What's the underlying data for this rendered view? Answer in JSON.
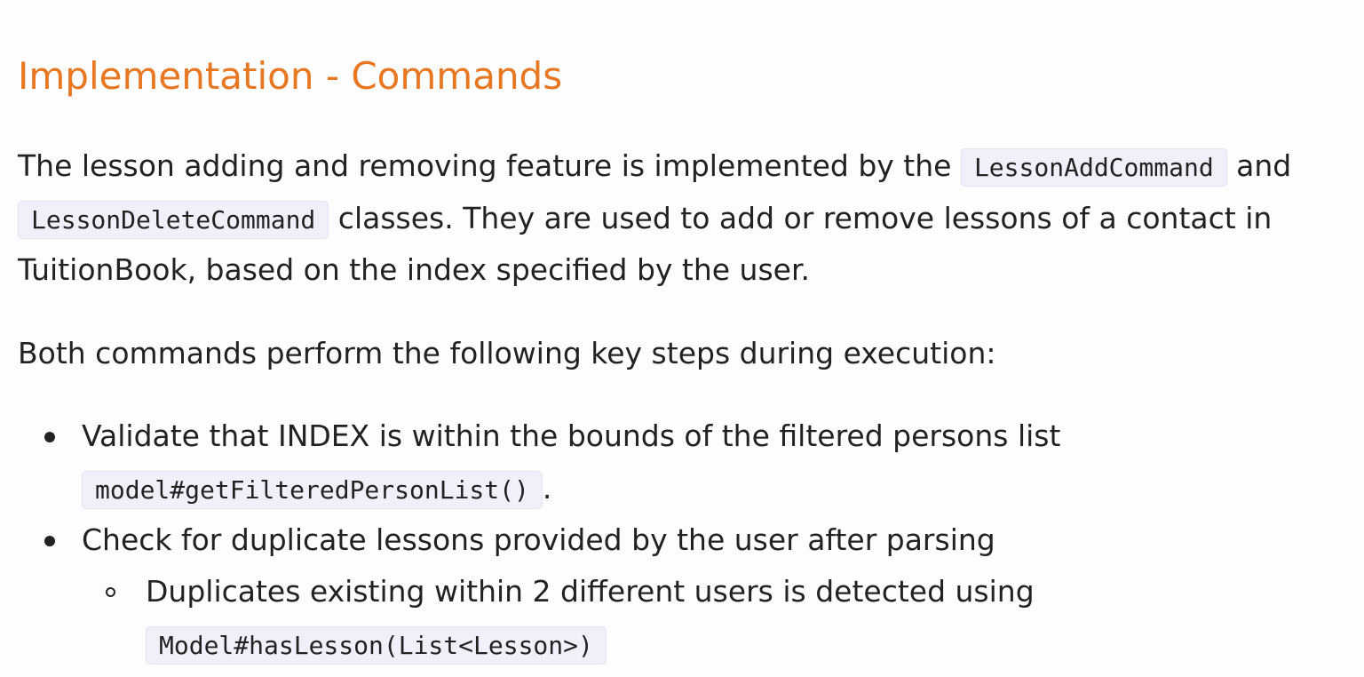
{
  "heading": "Implementation - Commands",
  "intro": {
    "line1_text": "The lesson adding and removing feature is implemented by the",
    "code_add": "LessonAddCommand",
    "line1_and": "and",
    "code_delete": "LessonDeleteCommand",
    "line2_text": "classes. They are used to add or remove lessons of a contact in",
    "line3_text": "TuitionBook, based on the index specified by the user."
  },
  "steps_intro": "Both commands perform the following key steps during execution:",
  "steps": [
    {
      "text": "Validate that INDEX is within the bounds of the filtered persons list",
      "code": "model#getFilteredPersonList()",
      "suffix": "."
    },
    {
      "text": "Check for duplicate lessons provided by the user after parsing",
      "subitems": [
        {
          "text": "Duplicates existing within 2 different users is detected using",
          "code": "Model#hasLesson(List<Lesson>)"
        }
      ]
    }
  ]
}
